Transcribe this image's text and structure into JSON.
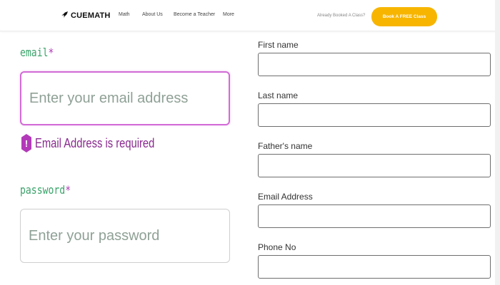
{
  "navbar": {
    "logo_text": "CUEMATH",
    "links": [
      "Math",
      "About Us",
      "Become a Teacher",
      "More"
    ],
    "booked_question": "Already Booked A Class?",
    "book_button": "Book A FREE Class",
    "accent_color": "#f7b500"
  },
  "login_form": {
    "email_label": "email",
    "required_mark": "*",
    "email_placeholder": "Enter your email address",
    "email_error": "Email Address is required",
    "error_icon_glyph": "!",
    "password_label": "password",
    "password_placeholder": "Enter your password",
    "label_color": "#3aa36a",
    "error_color": "#b03ab5"
  },
  "registration_form": {
    "first_name_label": "First name",
    "last_name_label": "Last name",
    "fathers_name_label": "Father's name",
    "email_label": "Email Address",
    "phone_label": "Phone No"
  }
}
